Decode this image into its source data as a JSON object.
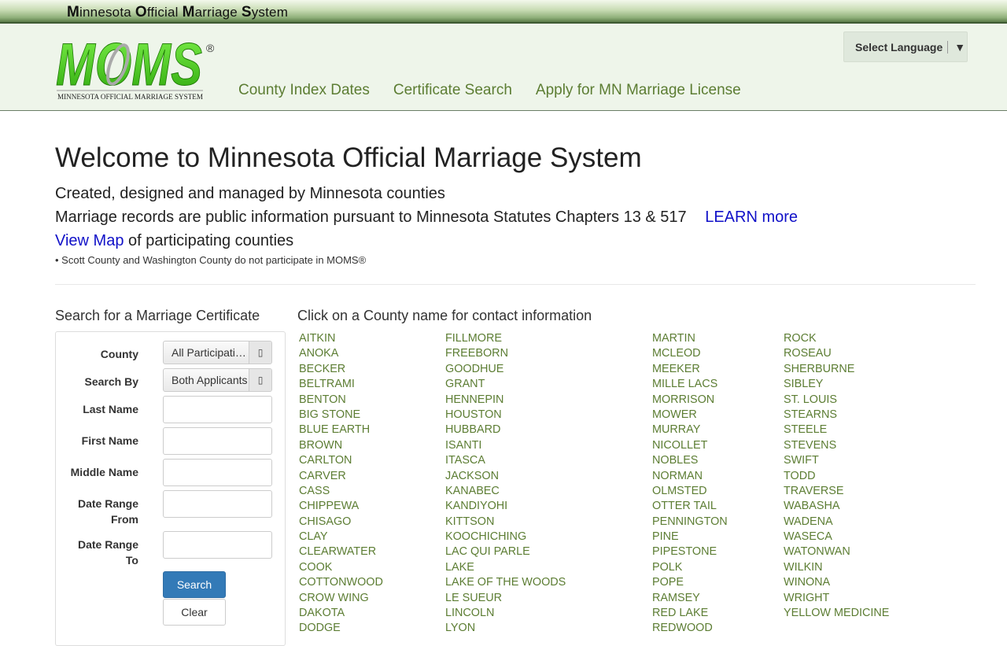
{
  "topbar": {
    "t1": "M",
    "t2": "innesota ",
    "t3": "O",
    "t4": "fficial ",
    "t5": "M",
    "t6": "arriage ",
    "t7": "S",
    "t8": "ystem"
  },
  "logo": {
    "mark": "MOMS",
    "subtitle": "MINNESOTA OFFICIAL MARRIAGE SYSTEM",
    "registered": "®"
  },
  "nav": {
    "items": [
      "County Index Dates",
      "Certificate Search",
      "Apply for MN Marriage License"
    ]
  },
  "language": {
    "label": "Select Language",
    "arrow": "▼"
  },
  "intro": {
    "title": "Welcome to Minnesota Official Marriage System",
    "line1": "Created, designed and managed by Minnesota counties",
    "line2": "Marriage records are public information pursuant to Minnesota Statutes Chapters 13 & 517",
    "learn_more": "LEARN more",
    "view_map": "View Map",
    "line3_rest": " of participating counties",
    "note": "• Scott County and Washington County do not participate in MOMS®"
  },
  "search": {
    "title": "Search for a Marriage Certificate",
    "county_label": "County",
    "county_value": "All Participating Counties",
    "search_by_label": "Search By",
    "search_by_value": "Both Applicants",
    "last_name_label": "Last Name",
    "first_name_label": "First Name",
    "middle_name_label": "Middle Name",
    "date_from_label_1": "Date Range",
    "date_from_label_2": "From",
    "date_to_label_1": "Date Range",
    "date_to_label_2": "To",
    "search_button": "Search",
    "clear_button": "Clear",
    "dropdown_arrow": "▯"
  },
  "counties": {
    "title": "Click on a County name for contact information",
    "columns": [
      [
        "AITKIN",
        "ANOKA",
        "BECKER",
        "BELTRAMI",
        "BENTON",
        "BIG STONE",
        "BLUE EARTH",
        "BROWN",
        "CARLTON",
        "CARVER",
        "CASS",
        "CHIPPEWA",
        "CHISAGO",
        "CLAY",
        "CLEARWATER",
        "COOK",
        "COTTONWOOD",
        "CROW WING",
        "DAKOTA",
        "DODGE"
      ],
      [
        "FILLMORE",
        "FREEBORN",
        "GOODHUE",
        "GRANT",
        "HENNEPIN",
        "HOUSTON",
        "HUBBARD",
        "ISANTI",
        "ITASCA",
        "JACKSON",
        "KANABEC",
        "KANDIYOHI",
        "KITTSON",
        "KOOCHICHING",
        "LAC QUI PARLE",
        "LAKE",
        "LAKE OF THE WOODS",
        "LE SUEUR",
        "LINCOLN",
        "LYON"
      ],
      [
        "MARTIN",
        "MCLEOD",
        "MEEKER",
        "MILLE LACS",
        "MORRISON",
        "MOWER",
        "MURRAY",
        "NICOLLET",
        "NOBLES",
        "NORMAN",
        "OLMSTED",
        "OTTER TAIL",
        "PENNINGTON",
        "PINE",
        "PIPESTONE",
        "POLK",
        "POPE",
        "RAMSEY",
        "RED LAKE",
        "REDWOOD"
      ],
      [
        "ROCK",
        "ROSEAU",
        "SHERBURNE",
        "SIBLEY",
        "ST. LOUIS",
        "STEARNS",
        "STEELE",
        "STEVENS",
        "SWIFT",
        "TODD",
        "TRAVERSE",
        "WABASHA",
        "WADENA",
        "WASECA",
        "WATONWAN",
        "WILKIN",
        "WINONA",
        "WRIGHT",
        "YELLOW MEDICINE"
      ]
    ]
  },
  "colors": {
    "link_green": "#5c7d33",
    "link_blue": "#1010c8",
    "logo_green": "#44d61a",
    "button_blue": "#337ab7"
  }
}
